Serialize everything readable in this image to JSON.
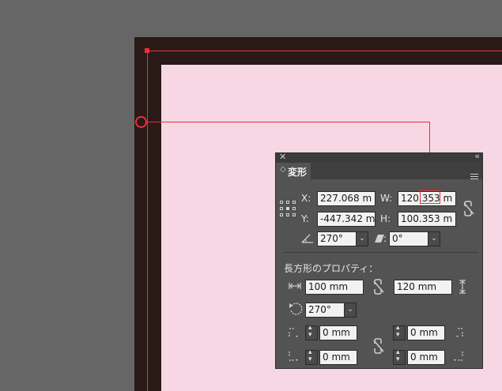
{
  "panel": {
    "tab_label": "変形",
    "x_label": "X:",
    "x_value": "227.068 m",
    "y_label": "Y:",
    "y_value": "-447.342 m",
    "w_label": "W:",
    "w_value": "120.353 m",
    "h_label": "H:",
    "h_value": "100.353 m",
    "rotate_value": "270°",
    "shear_value": "0°",
    "props_title": "長方形のプロパティ：",
    "rect_width": "100 mm",
    "rect_height": "120 mm",
    "rect_rotation": "270°",
    "corner_tl": "0 mm",
    "corner_tr": "0 mm",
    "corner_bl": "0 mm",
    "corner_br": "0 mm"
  },
  "colors": {
    "canvas": "#666666",
    "artboard_frame": "#291a17",
    "artboard_fill": "#f7d7e3",
    "selection": "#e8303a",
    "panel_bg": "#535353"
  }
}
